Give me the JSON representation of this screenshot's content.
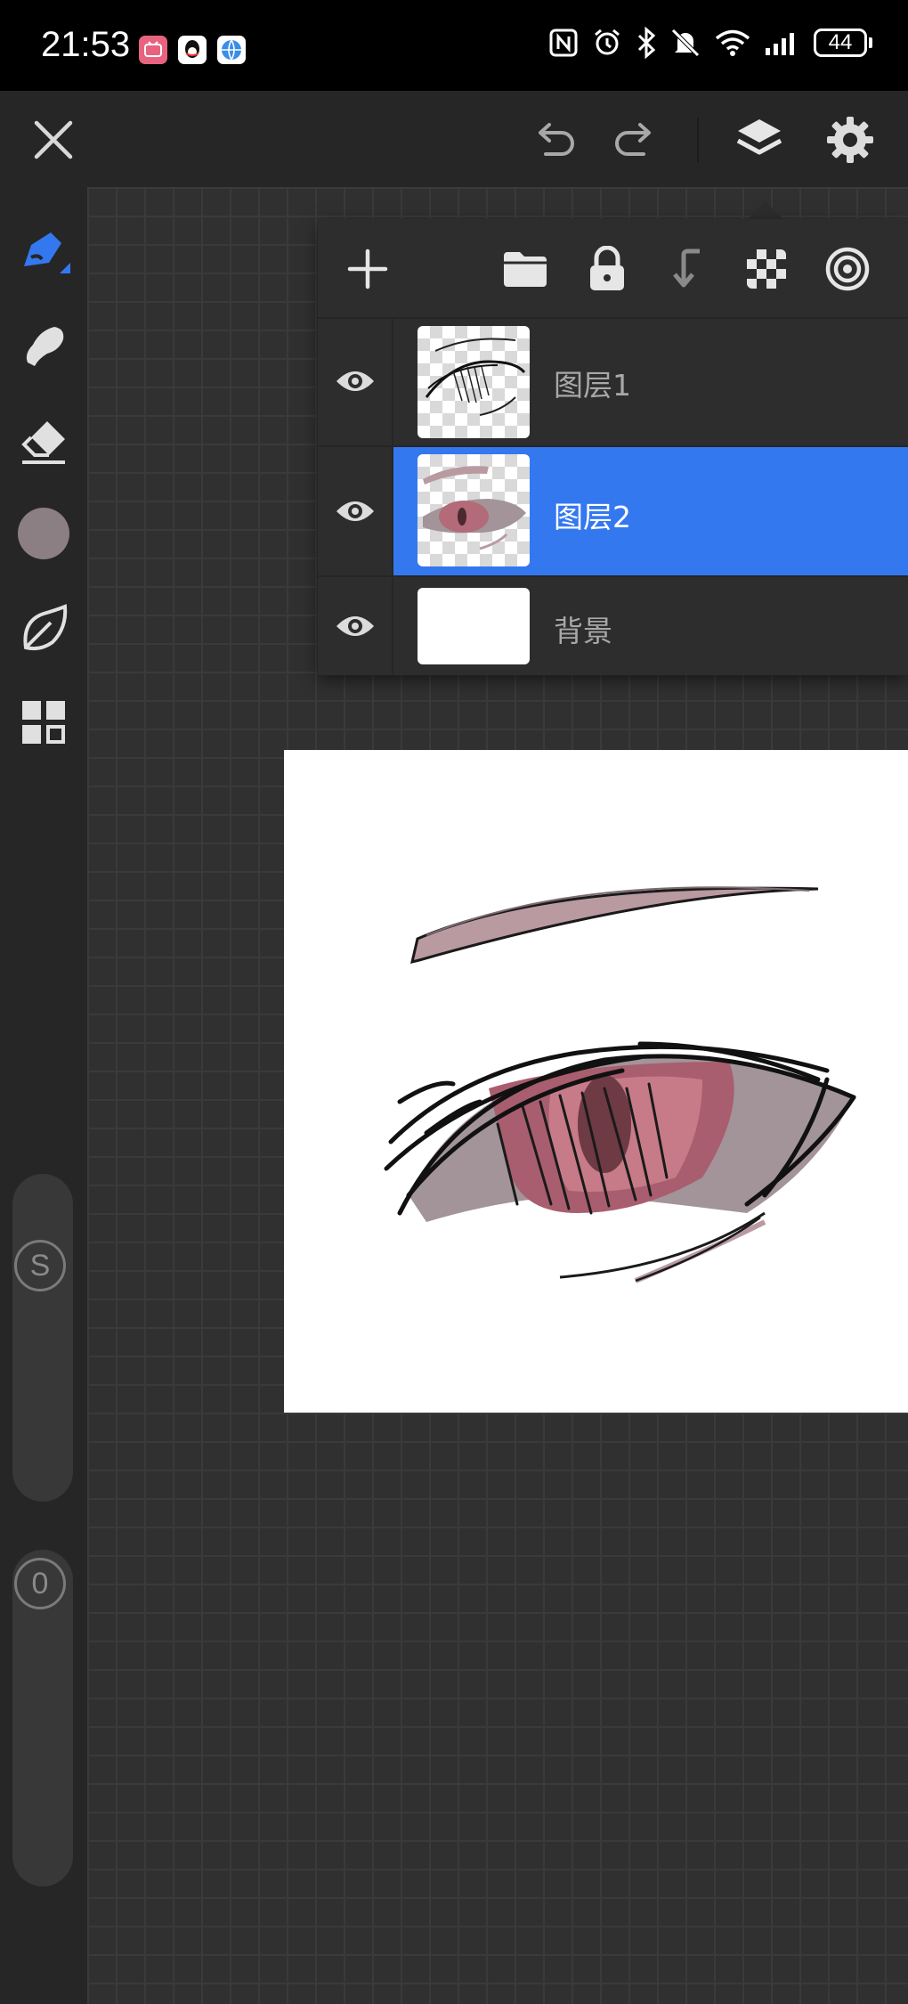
{
  "status_bar": {
    "time": "21:53",
    "battery": "44",
    "app_icons": [
      "bilibili-icon",
      "qq-icon",
      "browser-icon"
    ],
    "indicators": [
      "nfc-icon",
      "alarm-icon",
      "bluetooth-icon",
      "mute-icon",
      "wifi-icon",
      "signal-icon"
    ]
  },
  "toolbar": {
    "close": "close-icon",
    "undo": "undo-icon",
    "redo": "redo-icon",
    "layers": "layers-icon",
    "settings": "gear-icon"
  },
  "left_tools": [
    "pen-icon",
    "smudge-icon",
    "eraser-icon",
    "color-swatch",
    "leaf-icon",
    "grid-icon"
  ],
  "brush_color": "#8c7f84",
  "size_slider_label": "S",
  "opacity_slider_label": "0",
  "layers_panel": {
    "actions": [
      "add-icon",
      "folder-icon",
      "lock-icon",
      "merge-down-icon",
      "transparency-icon",
      "blend-icon"
    ],
    "layers": [
      {
        "name": "图层1",
        "visible": true,
        "selected": false
      },
      {
        "name": "图层2",
        "visible": true,
        "selected": true
      },
      {
        "name": "背景",
        "visible": true,
        "selected": false
      }
    ]
  },
  "colors": {
    "accent": "#3478f0",
    "background": "#2b2b2b",
    "panel": "#2d2d2d"
  }
}
